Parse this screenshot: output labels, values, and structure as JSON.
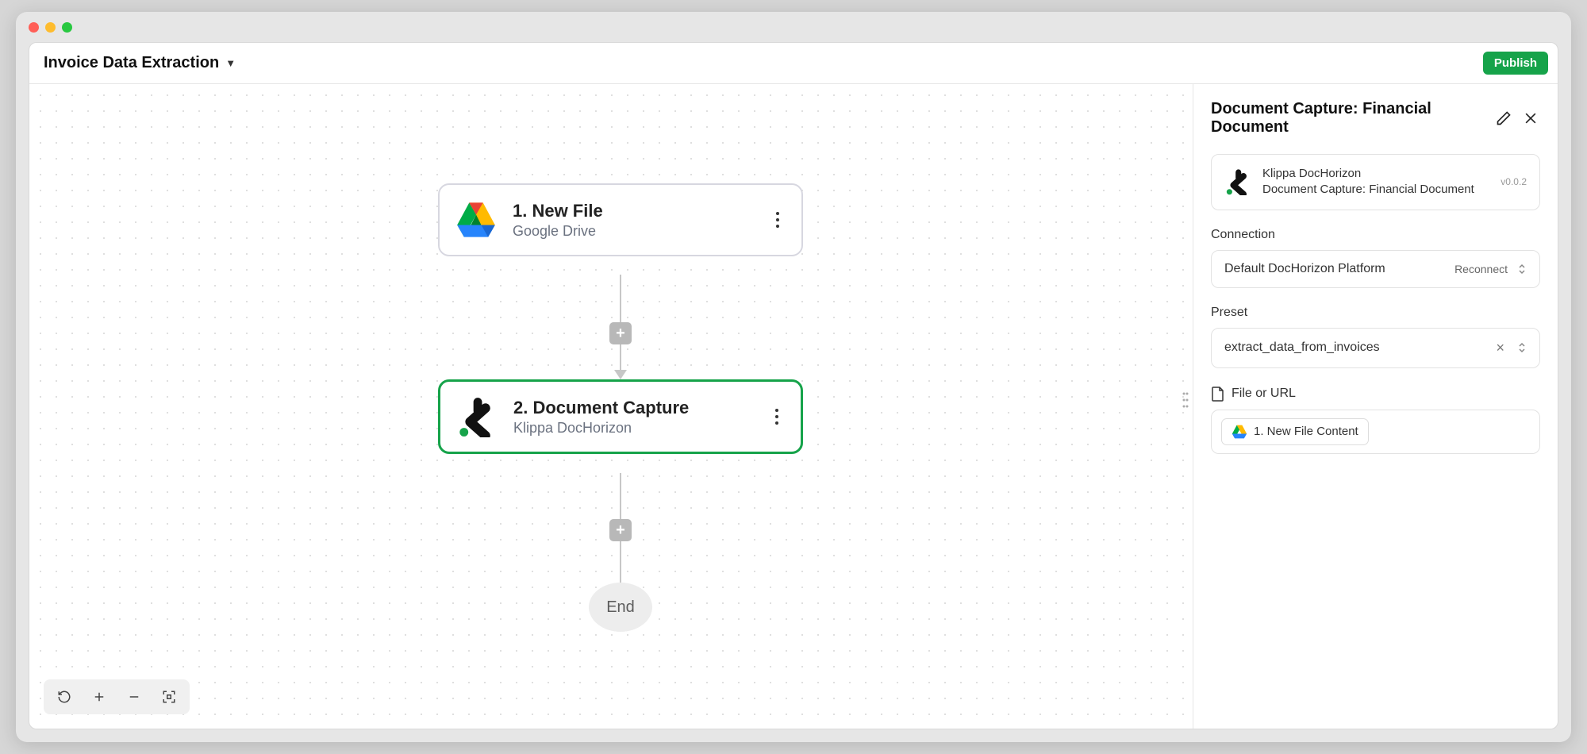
{
  "header": {
    "title": "Invoice Data Extraction",
    "publish_label": "Publish"
  },
  "nodes": [
    {
      "title": "1. New File",
      "sub": "Google Drive"
    },
    {
      "title": "2. Document Capture",
      "sub": "Klippa DocHorizon"
    }
  ],
  "end_label": "End",
  "sidebar": {
    "title": "Document Capture: Financial Document",
    "card": {
      "line1": "Klippa DocHorizon",
      "line2": "Document Capture: Financial Document",
      "version": "v0.0.2"
    },
    "connection": {
      "label": "Connection",
      "value": "Default DocHorizon Platform",
      "action": "Reconnect"
    },
    "preset": {
      "label": "Preset",
      "value": "extract_data_from_invoices"
    },
    "file": {
      "label": "File or URL",
      "chip_text": "1. New File Content"
    }
  }
}
